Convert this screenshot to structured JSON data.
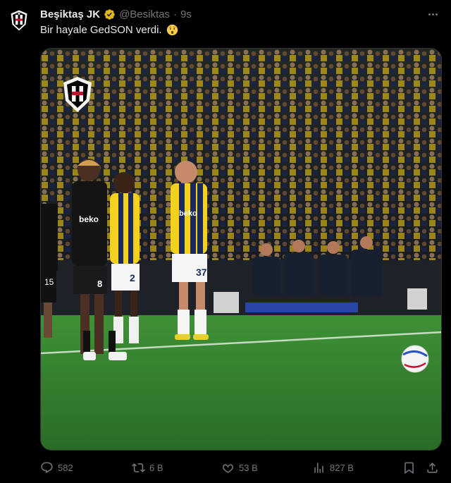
{
  "tweet": {
    "author_name": "Beşiktaş JK",
    "handle": "@Besiktas",
    "separator": "·",
    "time": "9s",
    "text": "Bir hayale GedSON verdi.",
    "emoji": "astonished-face",
    "media": {
      "type": "video-still",
      "player_numbers": [
        "15",
        "8",
        "2",
        "37"
      ],
      "sponsor_texts": [
        "beko",
        "beko"
      ],
      "club_crest": "BJK 1903"
    }
  },
  "actions": {
    "replies": "582",
    "reposts": "6 B",
    "likes": "53 B",
    "views": "827 B"
  },
  "colors": {
    "background": "#000000",
    "text_primary": "#e7e9ea",
    "text_secondary": "#71767b",
    "verified_badge": "#e2b719",
    "pitch": "#2f7d32",
    "fenerbahce_yellow": "#f3d11e",
    "fenerbahce_navy": "#1b2a5c"
  },
  "icons": [
    "bjk-crest-icon",
    "verified-badge-icon",
    "more-icon",
    "reply-icon",
    "repost-icon",
    "like-icon",
    "views-icon",
    "bookmark-icon",
    "share-icon"
  ]
}
